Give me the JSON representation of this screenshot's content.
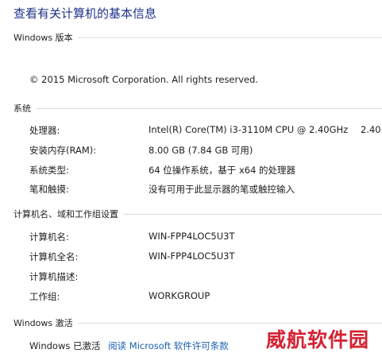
{
  "header": {
    "title": "查看有关计算机的基本信息"
  },
  "windows_edition": {
    "section_label": "Windows 版本",
    "copyright": "© 2015 Microsoft Corporation. All rights reserved."
  },
  "system": {
    "section_label": "系统",
    "rows": [
      {
        "label": "处理器:",
        "value": "Intel(R) Core(TM) i3-3110M CPU @ 2.40GHz",
        "extra": "2.40"
      },
      {
        "label": "安装内存(RAM):",
        "value": "8.00 GB (7.84 GB 可用)"
      },
      {
        "label": "系统类型:",
        "value": "64 位操作系统，基于 x64 的处理器"
      },
      {
        "label": "笔和触摸:",
        "value": "没有可用于此显示器的笔或触控输入"
      }
    ]
  },
  "computer": {
    "section_label": "计算机名、域和工作组设置",
    "rows": [
      {
        "label": "计算机名:",
        "value": "WIN-FPP4LOC5U3T"
      },
      {
        "label": "计算机全名:",
        "value": "WIN-FPP4LOC5U3T"
      },
      {
        "label": "计算机描述:",
        "value": ""
      },
      {
        "label": "工作组:",
        "value": "WORKGROUP"
      }
    ]
  },
  "activation": {
    "section_label": "Windows 激活",
    "status": "Windows 已激活",
    "link": "阅读 Microsoft 软件许可条款"
  },
  "watermark": {
    "text": "威航软件园"
  },
  "colors": {
    "title": "#1e3287",
    "link": "#1a5fb4",
    "rule": "#d5dfe5",
    "watermark": "#d42233"
  }
}
